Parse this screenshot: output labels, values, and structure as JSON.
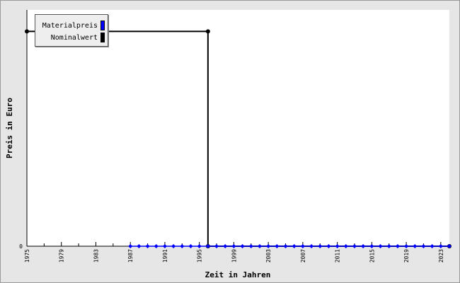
{
  "chart_data": {
    "type": "line",
    "xlabel": "Zeit in Jahren",
    "ylabel": "Preis in Euro",
    "x_ticks": [
      "1975",
      "1979",
      "1983",
      "1987",
      "1991",
      "1995",
      "1999",
      "2003",
      "2007",
      "2011",
      "2015",
      "2019",
      "2023"
    ],
    "y_ticks": [
      "0"
    ],
    "xlim": [
      1975,
      2024
    ],
    "ylim": [
      0,
      1.1
    ],
    "series": [
      {
        "name": "Materialpreis",
        "color": "#0000ff",
        "marker": "diamond",
        "x": [
          1987,
          1988,
          1989,
          1990,
          1991,
          1992,
          1993,
          1994,
          1995,
          1996,
          1997,
          1998,
          1999,
          2000,
          2001,
          2002,
          2003,
          2004,
          2005,
          2006,
          2007,
          2008,
          2009,
          2010,
          2011,
          2012,
          2013,
          2014,
          2015,
          2016,
          2017,
          2018,
          2019,
          2020,
          2021,
          2022,
          2023,
          2024
        ],
        "y": [
          0,
          0,
          0,
          0,
          0,
          0,
          0,
          0,
          0,
          0,
          0,
          0,
          0,
          0,
          0,
          0,
          0,
          0,
          0,
          0,
          0,
          0,
          0,
          0,
          0,
          0,
          0,
          0,
          0,
          0,
          0,
          0,
          0,
          0,
          0,
          0,
          0,
          0
        ]
      },
      {
        "name": "Nominalwert",
        "color": "#000000",
        "marker": "circle",
        "step": true,
        "x": [
          1975,
          1996,
          1996,
          2024
        ],
        "y": [
          1,
          1,
          0,
          0
        ]
      }
    ],
    "legend_position": "top-left",
    "grid": false
  }
}
